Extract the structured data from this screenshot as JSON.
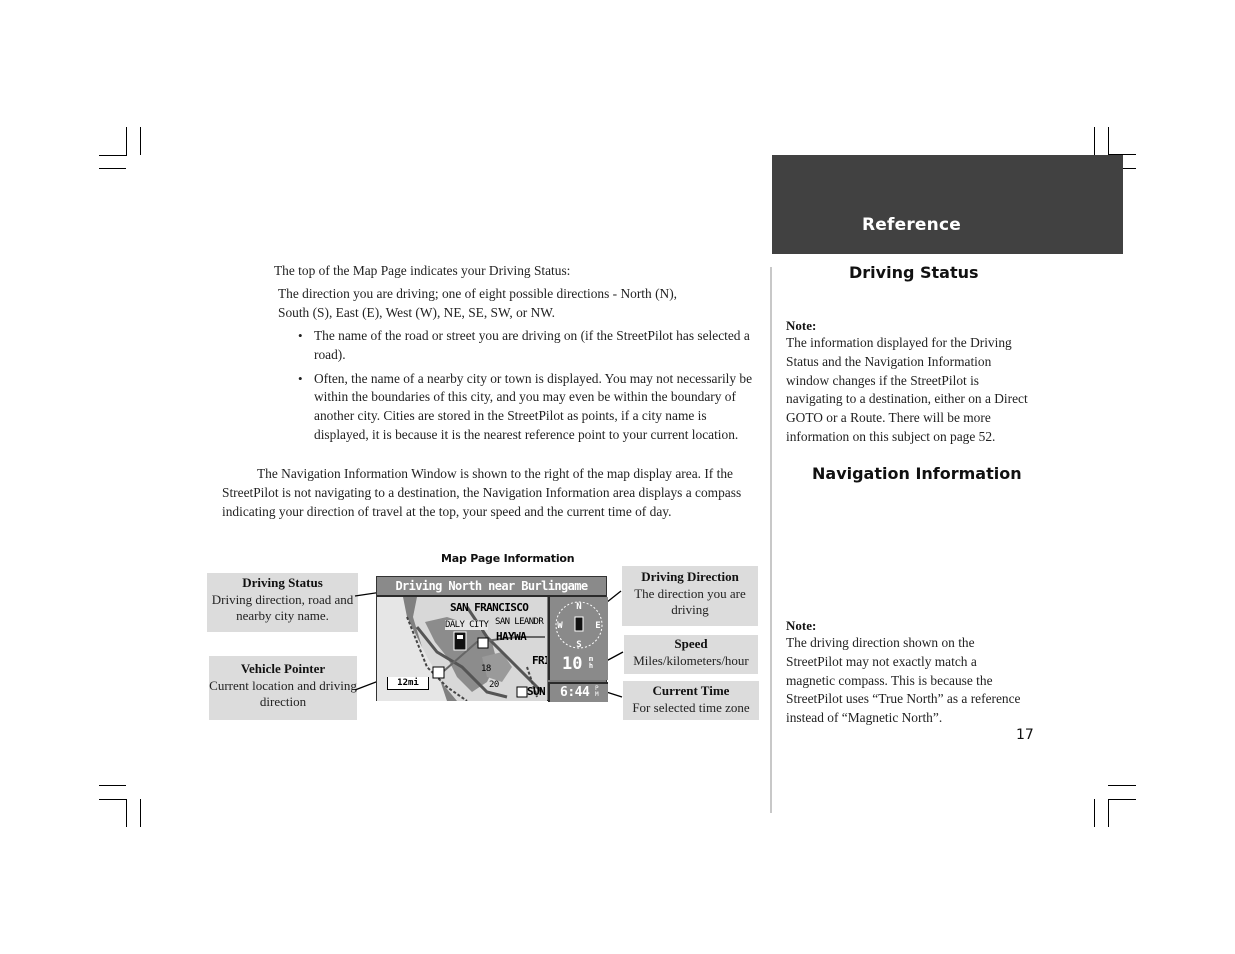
{
  "section_tab": {
    "title": "Reference"
  },
  "driving_status": {
    "heading": "Driving Status",
    "intro": "The top of the Map Page indicates your Driving Status:",
    "direction_text": "The direction you are driving; one of eight possible directions - North (N), South (S), East (E), West (W), NE, SE, SW, or NW.",
    "bullets": [
      "The name of the road or street you are driving on (if the StreetPilot has selected a road).",
      "Often, the name of a nearby city or town is displayed. You may not necessarily be within the boundaries of this city, and you may even be within the boundary of another city. Cities are stored in the StreetPilot as points, if a city name is displayed, it is because it is the nearest reference point to your current location."
    ]
  },
  "notes": [
    {
      "label": "Note:",
      "text": "The information displayed for the Driving Status and the Navigation Information window changes if the StreetPilot is navigating to a destination, either on a Direct GOTO or a Route. There will be more information on this subject on page 52."
    },
    {
      "label": "Note:",
      "text": "The driving direction shown on the StreetPilot may not exactly match a magnetic compass. This is because the StreetPilot uses “True North” as a reference instead of “Magnetic North”."
    }
  ],
  "navigation_information": {
    "heading": "Navigation Information",
    "paragraph": "The Navigation Information Window is shown to the right of the map display area. If the StreetPilot is not navigating to a destination, the Navigation Information area displays a compass indicating your direction of travel at the top, your speed and the current time of day."
  },
  "figure": {
    "caption": "Map Page Information",
    "callouts": {
      "driving_status": {
        "title": "Driving Status",
        "text": "Driving direction, road and nearby city name."
      },
      "vehicle_pointer": {
        "title": "Vehicle Pointer",
        "text": "Current location and driving direction"
      },
      "driving_direction": {
        "title": "Driving Direction",
        "text": "The direction you are driving"
      },
      "speed": {
        "title": "Speed",
        "text": "Miles/kilometers/hour"
      },
      "current_time": {
        "title": "Current Time",
        "text": "For selected time zone"
      }
    },
    "screen": {
      "status_bar": "Driving North near Burlingame",
      "map_labels": [
        "SAN FRANCISCO",
        "DALY CITY",
        "SAN LEANDR",
        "HAYWA",
        "FRI",
        "SUN"
      ],
      "road_numbers": [
        "18",
        "20"
      ],
      "scale": "12mi",
      "compass": {
        "n": "N",
        "s": "S",
        "e": "E",
        "w": "W"
      },
      "speed_value": "10",
      "speed_unit_top": "m",
      "speed_unit_bottom": "h",
      "time_value": "6:44",
      "time_ampm_top": "P",
      "time_ampm_bottom": "M"
    }
  },
  "page_number": "17"
}
